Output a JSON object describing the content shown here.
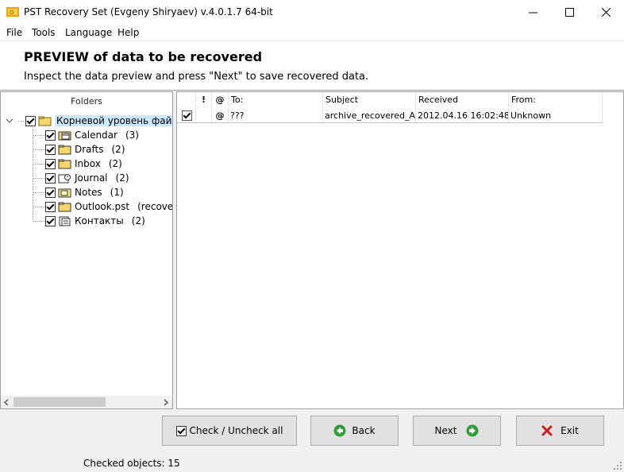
{
  "window": {
    "title": "PST Recovery Set (Evgeny Shiryaev) v.4.0.1.7 64-bit",
    "app_icon": "outlook-envelope-icon",
    "controls": [
      "minimize-icon",
      "maximize-icon",
      "close-icon"
    ]
  },
  "menu": {
    "items": [
      "File",
      "Tools",
      "Language",
      "Help"
    ]
  },
  "header": {
    "title": "PREVIEW of data to be recovered",
    "subtitle": "Inspect the data preview and press \"Next\" to save recovered data."
  },
  "folders": {
    "header": "Folders",
    "root": {
      "label": "Корневой уровень файла,",
      "checked": true,
      "icon": "root-folder-icon"
    },
    "items": [
      {
        "label": "Calendar",
        "count": "(3)",
        "checked": true,
        "icon": "calendar-folder-icon"
      },
      {
        "label": "Drafts",
        "count": "(2)",
        "checked": true,
        "icon": "drafts-folder-icon"
      },
      {
        "label": "Inbox",
        "count": "(2)",
        "checked": true,
        "icon": "inbox-folder-icon"
      },
      {
        "label": "Journal",
        "count": "(2)",
        "checked": true,
        "icon": "journal-folder-icon"
      },
      {
        "label": "Notes",
        "count": "(1)",
        "checked": true,
        "icon": "notes-folder-icon"
      },
      {
        "label": "Outlook.pst",
        "count": "(recovere",
        "checked": true,
        "icon": "pst-folder-icon"
      },
      {
        "label": "Контакты",
        "count": "(2)",
        "checked": true,
        "icon": "contacts-folder-icon"
      }
    ]
  },
  "messages": {
    "columns": {
      "importance": "!",
      "attachment": "@",
      "to": "To:",
      "subject": "Subject",
      "received": "Received",
      "from": "From:"
    },
    "rows": [
      {
        "checked": true,
        "attachment": "@",
        "to": "???",
        "subject": "archive_recovered_AOI",
        "received": "2012.04.16 16:02:48",
        "from": "Unknown"
      }
    ]
  },
  "buttons": {
    "check_all": "Check / Uncheck all",
    "back": "Back",
    "next": "Next",
    "exit": "Exit"
  },
  "status": {
    "checked_objects": "Checked objects: 15"
  },
  "colors": {
    "back_arrow": "#2e9c3a",
    "next_arrow": "#2e9c3a",
    "exit_x": "#c81e1e",
    "selection_bg": "#cce8ff"
  }
}
